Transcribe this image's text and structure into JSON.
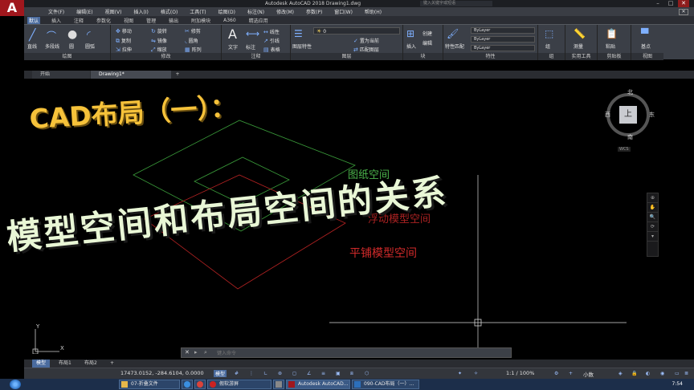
{
  "app": {
    "logo_letter": "A",
    "title": "Autodesk AutoCAD 2018    Drawing1.dwg",
    "search_placeholder": "键入关键字或短语",
    "window_buttons": [
      "–",
      "□",
      "✕"
    ]
  },
  "menubar": [
    "文件(F)",
    "编辑(E)",
    "视图(V)",
    "插入(I)",
    "格式(O)",
    "工具(T)",
    "绘图(D)",
    "标注(N)",
    "修改(M)",
    "参数(P)",
    "窗口(W)",
    "帮助(H)"
  ],
  "ribbon_tabs": [
    "默认",
    "插入",
    "注释",
    "参数化",
    "视图",
    "管理",
    "输出",
    "附加模块",
    "A360",
    "精选应用"
  ],
  "active_ribbon_tab": "默认",
  "ribbon": {
    "draw": {
      "label": "绘图",
      "tools": [
        "直线",
        "多段线",
        "圆",
        "圆弧"
      ]
    },
    "modify": {
      "label": "修改",
      "tools": [
        "移动",
        "旋转",
        "修剪",
        "复制",
        "镜像",
        "圆角",
        "拉伸",
        "缩放",
        "阵列"
      ]
    },
    "annotation": {
      "label": "注释",
      "tools": [
        "文字",
        "标注",
        "线性",
        "引线",
        "表格"
      ]
    },
    "layers": {
      "label": "图层",
      "tools": [
        "图层特性",
        "置为当前",
        "匹配图层"
      ],
      "current_layer": "0"
    },
    "block": {
      "label": "块",
      "tools": [
        "插入",
        "创建",
        "编辑"
      ]
    },
    "properties": {
      "label": "特性",
      "tools": [
        "特性匹配"
      ],
      "values": [
        "ByLayer",
        "ByLayer",
        "ByLayer"
      ]
    },
    "groups": {
      "label": "组",
      "tools": [
        "组"
      ]
    },
    "utilities": {
      "label": "实用工具",
      "tools": [
        "测量"
      ]
    },
    "clipboard": {
      "label": "剪贴板",
      "tools": [
        "粘贴"
      ]
    },
    "view": {
      "label": "视图",
      "tools": [
        "基点"
      ]
    }
  },
  "file_tabs": [
    "开始",
    "Drawing1*",
    "+"
  ],
  "canvas": {
    "overlay_title": "CAD布局（一）：",
    "overlay_subtitle": "模型空间和布局空间的关系",
    "label_paper": "图纸空间",
    "label_flat": "平铺模型空间",
    "label_hidden": "浮动模型空间",
    "ucs_y": "Y",
    "ucs_x": "X"
  },
  "navcube": {
    "north": "北",
    "south": "南",
    "east": "东",
    "west": "西",
    "face": "上",
    "wcs": "WCS"
  },
  "navbar_glyphs": [
    "⊕",
    "✋",
    "🔍",
    "⟳",
    "▾"
  ],
  "command": {
    "close": "✕",
    "placeholder": "键入命令"
  },
  "layout_tabs": [
    "模型",
    "布局1",
    "布局2",
    "+"
  ],
  "status": {
    "coords": "17473.0152, -284.6104, 0.0000",
    "mode": "模型",
    "scale": "1:1 / 100%",
    "units": "小数"
  },
  "taskbar": {
    "items": [
      "07-折叠文件",
      "",
      "",
      "假软游屏",
      "",
      "Autodesk AutoCAD...",
      "090-CAD布局（一）..."
    ],
    "clock": "7:54"
  },
  "colors": {
    "paper_green": "#4bb34b",
    "flat_red": "#d12a2a",
    "title_yellow": "#f6c23a",
    "title_green": "#e9f7d6",
    "ribbon_bg": "#3b3f47",
    "accent_blue": "#4a6b9e"
  }
}
